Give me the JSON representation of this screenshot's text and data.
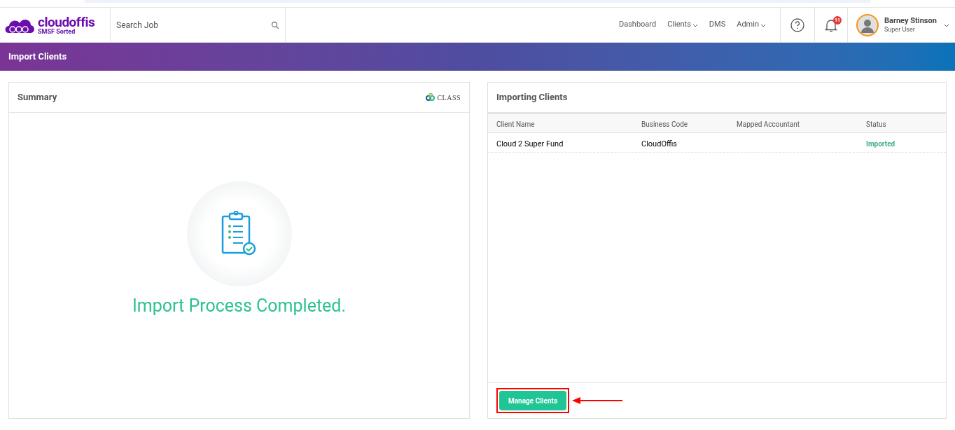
{
  "header": {
    "logo": {
      "name": "cloudoffis",
      "tagline": "SMSF Sorted"
    },
    "search": {
      "placeholder": "Search Job"
    },
    "nav": [
      {
        "label": "Dashboard",
        "dropdown": false
      },
      {
        "label": "Clients",
        "dropdown": true
      },
      {
        "label": "DMS",
        "dropdown": false
      },
      {
        "label": "Admin",
        "dropdown": true
      }
    ],
    "notifications": "11",
    "user": {
      "name": "Barney Stinson",
      "role": "Super User"
    }
  },
  "page_title": "Import Clients",
  "summary": {
    "title": "Summary",
    "brand": "CLASS",
    "message": "Import Process Completed."
  },
  "importing": {
    "title": "Importing Clients",
    "columns": [
      "Client Name",
      "Business Code",
      "Mapped Accountant",
      "Status"
    ],
    "rows": [
      {
        "client_name": "Cloud 2 Super Fund",
        "business_code": "CloudOffis",
        "mapped_accountant": "",
        "status": "Imported"
      }
    ],
    "button": "Manage Clients",
    "highlighted": true
  }
}
